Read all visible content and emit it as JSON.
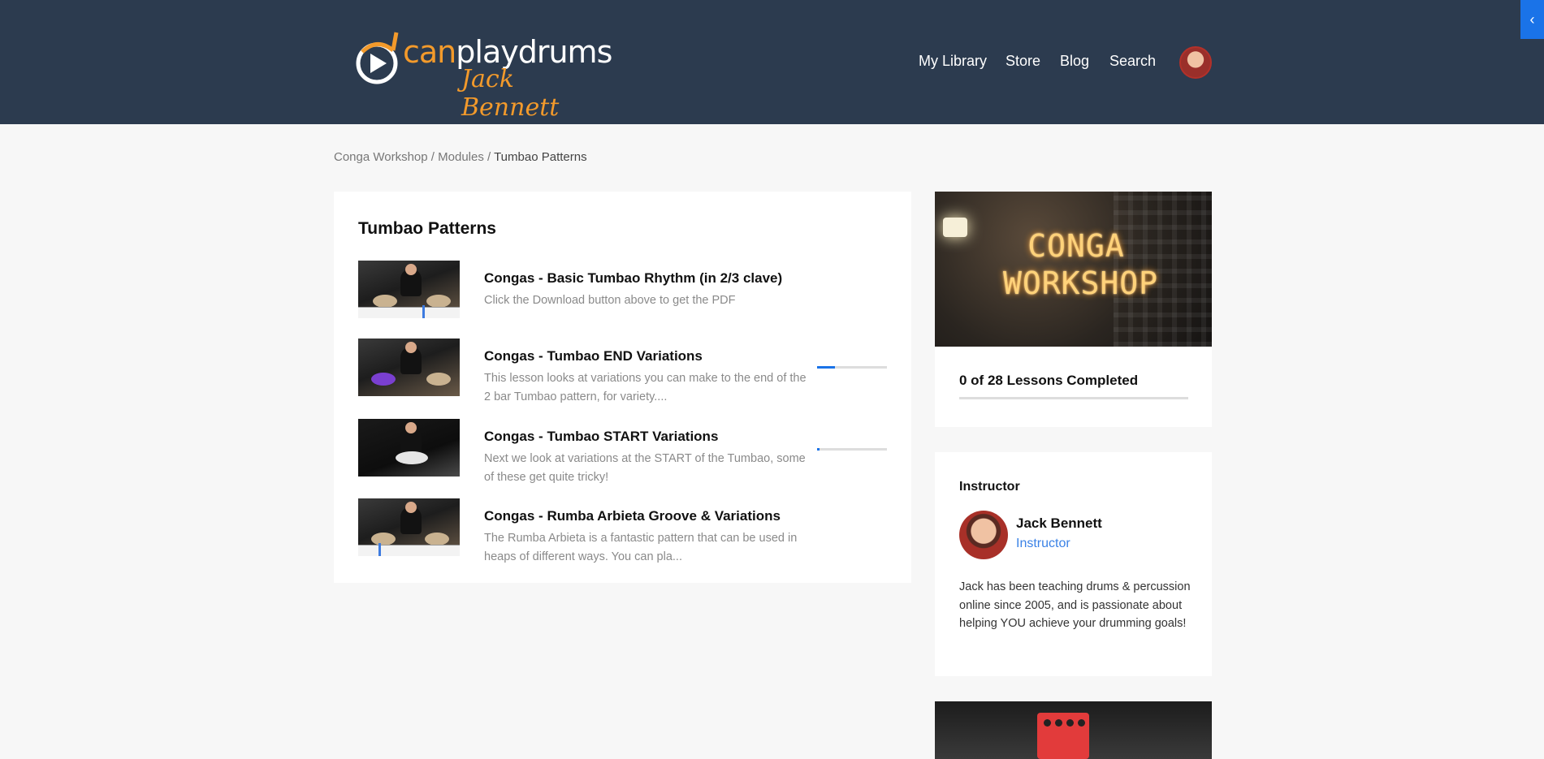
{
  "header": {
    "brand": {
      "prefix": "can",
      "suffix": "playdrums",
      "signature": "Jack Bennett"
    },
    "nav": [
      "My Library",
      "Store",
      "Blog",
      "Search"
    ],
    "side_toggle_icon": "‹"
  },
  "breadcrumb": {
    "items": [
      "Conga Workshop",
      "Modules",
      "Tumbao Patterns"
    ],
    "separator": " / "
  },
  "module": {
    "title": "Tumbao Patterns",
    "lessons": [
      {
        "title": "Congas - Basic Tumbao Rhythm (in 2/3 clave)",
        "description": "Click the Download button above to get the PDF",
        "progress": null
      },
      {
        "title": "Congas - Tumbao END Variations",
        "description": "This lesson looks at variations you can make to the end of the 2 bar Tumbao pattern, for variety....",
        "progress": 0.25
      },
      {
        "title": "Congas - Tumbao START Variations",
        "description": "Next we look at variations at the START of the Tumbao, some of these get quite tricky!",
        "progress": 0.03
      },
      {
        "title": "Congas - Rumba Arbieta Groove & Variations",
        "description": "The Rumba Arbieta is a fantastic pattern that can be used in heaps of different ways. You can pla...",
        "progress": null
      }
    ]
  },
  "course": {
    "image_text": "CONGA WORKSHOP",
    "lessons_completed": "0 of 28 Lessons Completed",
    "completion": 0
  },
  "instructor": {
    "heading": "Instructor",
    "name": "Jack Bennett",
    "role": "Instructor",
    "bio": "Jack has been teaching drums & percussion online since 2005, and is passionate about helping YOU achieve your drumming goals!"
  },
  "colors": {
    "header_bg": "#2c3b4f",
    "accent": "#1a73e8",
    "brand_orange": "#f39a2b"
  }
}
